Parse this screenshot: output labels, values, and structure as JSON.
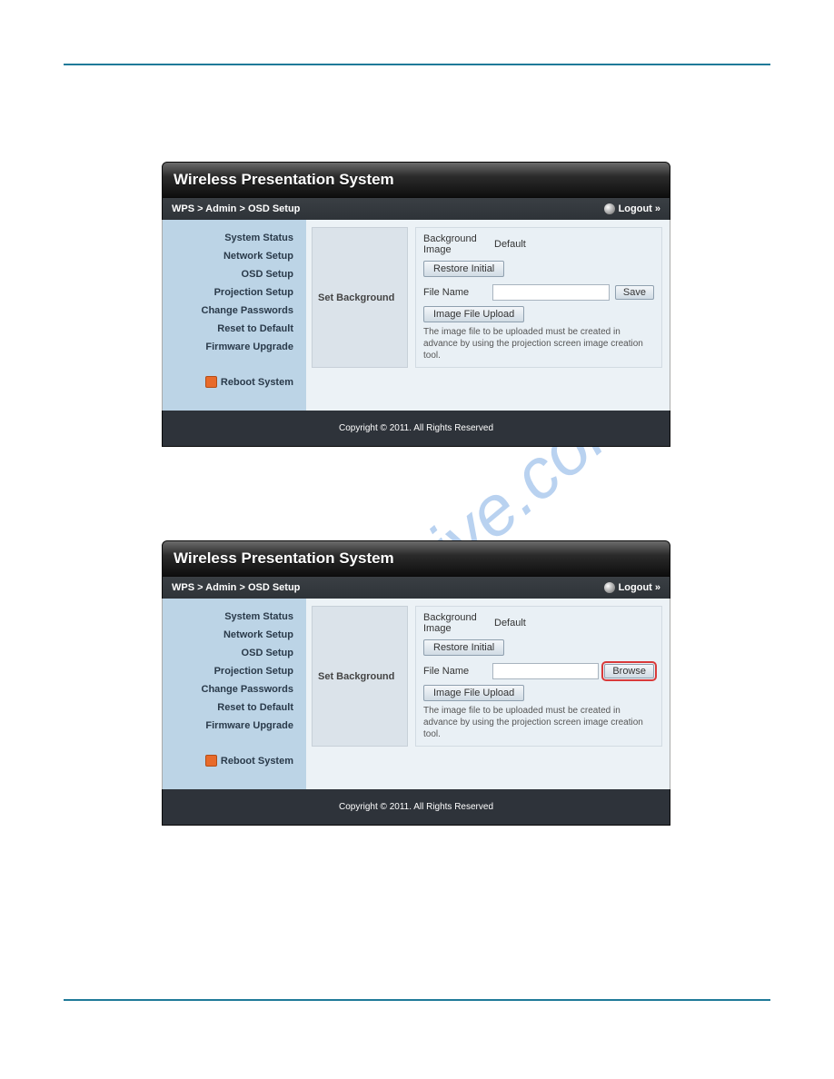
{
  "watermark_text": "manualshive.com",
  "app_title": "Wireless Presentation System",
  "breadcrumb": "WPS > Admin > OSD Setup",
  "logout_label": "Logout »",
  "sidebar": {
    "items": [
      "System Status",
      "Network Setup",
      "OSD Setup",
      "Projection Setup",
      "Change Passwords",
      "Reset to Default",
      "Firmware Upgrade"
    ],
    "reboot_label": "Reboot System"
  },
  "section": {
    "heading": "Set Background",
    "bg_image_label": "Background Image",
    "bg_image_value": "Default",
    "restore_btn": "Restore Initial",
    "file_name_label": "File Name",
    "upload_btn": "Image File Upload",
    "note": "The image file to be uploaded must be created in advance by using the projection screen image creation tool."
  },
  "panel1": {
    "right_button": "Save"
  },
  "panel2": {
    "right_button": "Browse"
  },
  "footer": "Copyright © 2011. All Rights Reserved"
}
